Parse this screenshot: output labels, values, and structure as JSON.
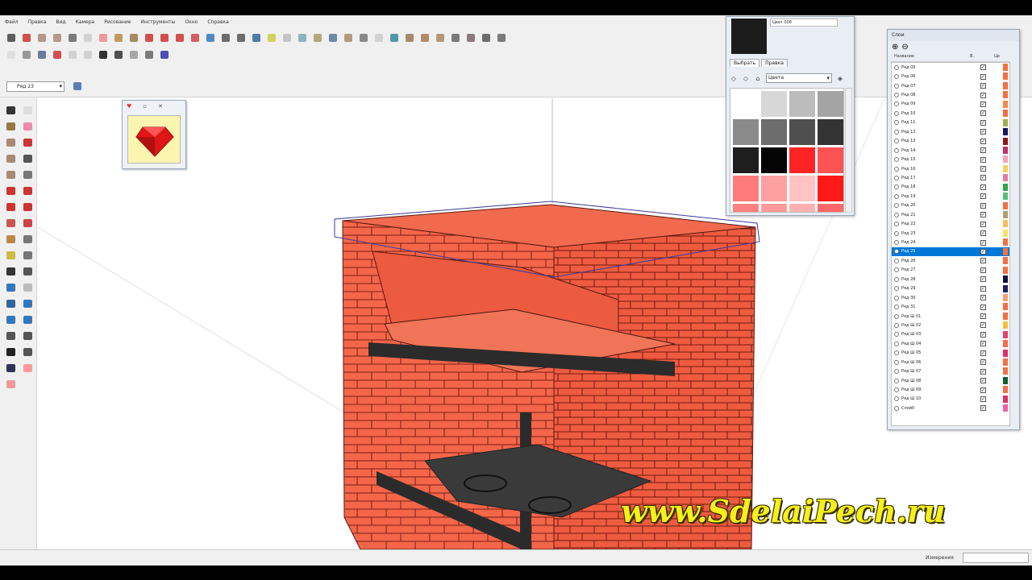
{
  "menu": [
    "Файл",
    "Правка",
    "Вид",
    "Камера",
    "Рисование",
    "Инструменты",
    "Окно",
    "Справка"
  ],
  "toolbar": {
    "layer_select_value": "Ряд 23"
  },
  "colors_panel": {
    "color_name": "Цвет 008",
    "tabs": [
      "Выбрать",
      "Правка"
    ],
    "library_select": "Цвета",
    "swatches": [
      "#ffffff",
      "#d7d7d7",
      "#bcbcbc",
      "#a4a4a4",
      "#8a8a8a",
      "#6d6d6d",
      "#4f4f4f",
      "#333333",
      "#1e1e1e",
      "#050505",
      "#ff2424",
      "#ff5252",
      "#ff7a7a",
      "#ffa0a0",
      "#ffc3c3",
      "#ff1818",
      "#ff8080",
      "#ff9999",
      "#ffb0b0",
      "#ff6868"
    ]
  },
  "layers_panel": {
    "title": "Слои",
    "header_name": "Название",
    "header_visible": "В..",
    "header_color": "Цв",
    "selected": "Ряд 25",
    "rows": [
      {
        "name": "Ряд 05",
        "color": "#f37043"
      },
      {
        "name": "Ряд 06",
        "color": "#f37043"
      },
      {
        "name": "Ряд 07",
        "color": "#f37043"
      },
      {
        "name": "Ряд 08",
        "color": "#f37043"
      },
      {
        "name": "Ряд 09",
        "color": "#f48a4a"
      },
      {
        "name": "Ряд 10",
        "color": "#f37043"
      },
      {
        "name": "Ряд 11",
        "color": "#a1b050"
      },
      {
        "name": "Ряд 12",
        "color": "#161660"
      },
      {
        "name": "Ряд 13",
        "color": "#8b1a1a"
      },
      {
        "name": "Ряд 14",
        "color": "#c0306a"
      },
      {
        "name": "Ряд 15",
        "color": "#f3a4b8"
      },
      {
        "name": "Ряд 16",
        "color": "#f6d25a"
      },
      {
        "name": "Ряд 17",
        "color": "#e37aa0"
      },
      {
        "name": "Ряд 18",
        "color": "#2aa84a"
      },
      {
        "name": "Ряд 19",
        "color": "#55c07a"
      },
      {
        "name": "Ряд 20",
        "color": "#f37043"
      },
      {
        "name": "Ряд 21",
        "color": "#b0a070"
      },
      {
        "name": "Ряд 22",
        "color": "#f0c060"
      },
      {
        "name": "Ряд 23",
        "color": "#f6e36a"
      },
      {
        "name": "Ряд 24",
        "color": "#f37043"
      },
      {
        "name": "Ряд 25",
        "color": "#f37043"
      },
      {
        "name": "Ряд 26",
        "color": "#f37043"
      },
      {
        "name": "Ряд 27",
        "color": "#f37043"
      },
      {
        "name": "Ряд 28",
        "color": "#101040"
      },
      {
        "name": "Ряд 29",
        "color": "#202060"
      },
      {
        "name": "Ряд 30",
        "color": "#f3a070"
      },
      {
        "name": "Ряд 31",
        "color": "#f37043"
      },
      {
        "name": "Ряд Ш 01",
        "color": "#f37043"
      },
      {
        "name": "Ряд Ш 02",
        "color": "#f6c040"
      },
      {
        "name": "Ряд Ш 03",
        "color": "#e34070"
      },
      {
        "name": "Ряд Ш 04",
        "color": "#f37043"
      },
      {
        "name": "Ряд Ш 05",
        "color": "#e0306a"
      },
      {
        "name": "Ряд Ш 06",
        "color": "#f37043"
      },
      {
        "name": "Ряд Ш 07",
        "color": "#f37043"
      },
      {
        "name": "Ряд Ш 08",
        "color": "#106030"
      },
      {
        "name": "Ряд Ш 09",
        "color": "#f37043"
      },
      {
        "name": "Ряд Ш 10",
        "color": "#e0306a"
      },
      {
        "name": "Слой0",
        "color": "#f060a0"
      }
    ]
  },
  "status": {
    "measure_label": "Измерения",
    "measure_value": ""
  },
  "watermark": "www.SdelaiPech.ru"
}
